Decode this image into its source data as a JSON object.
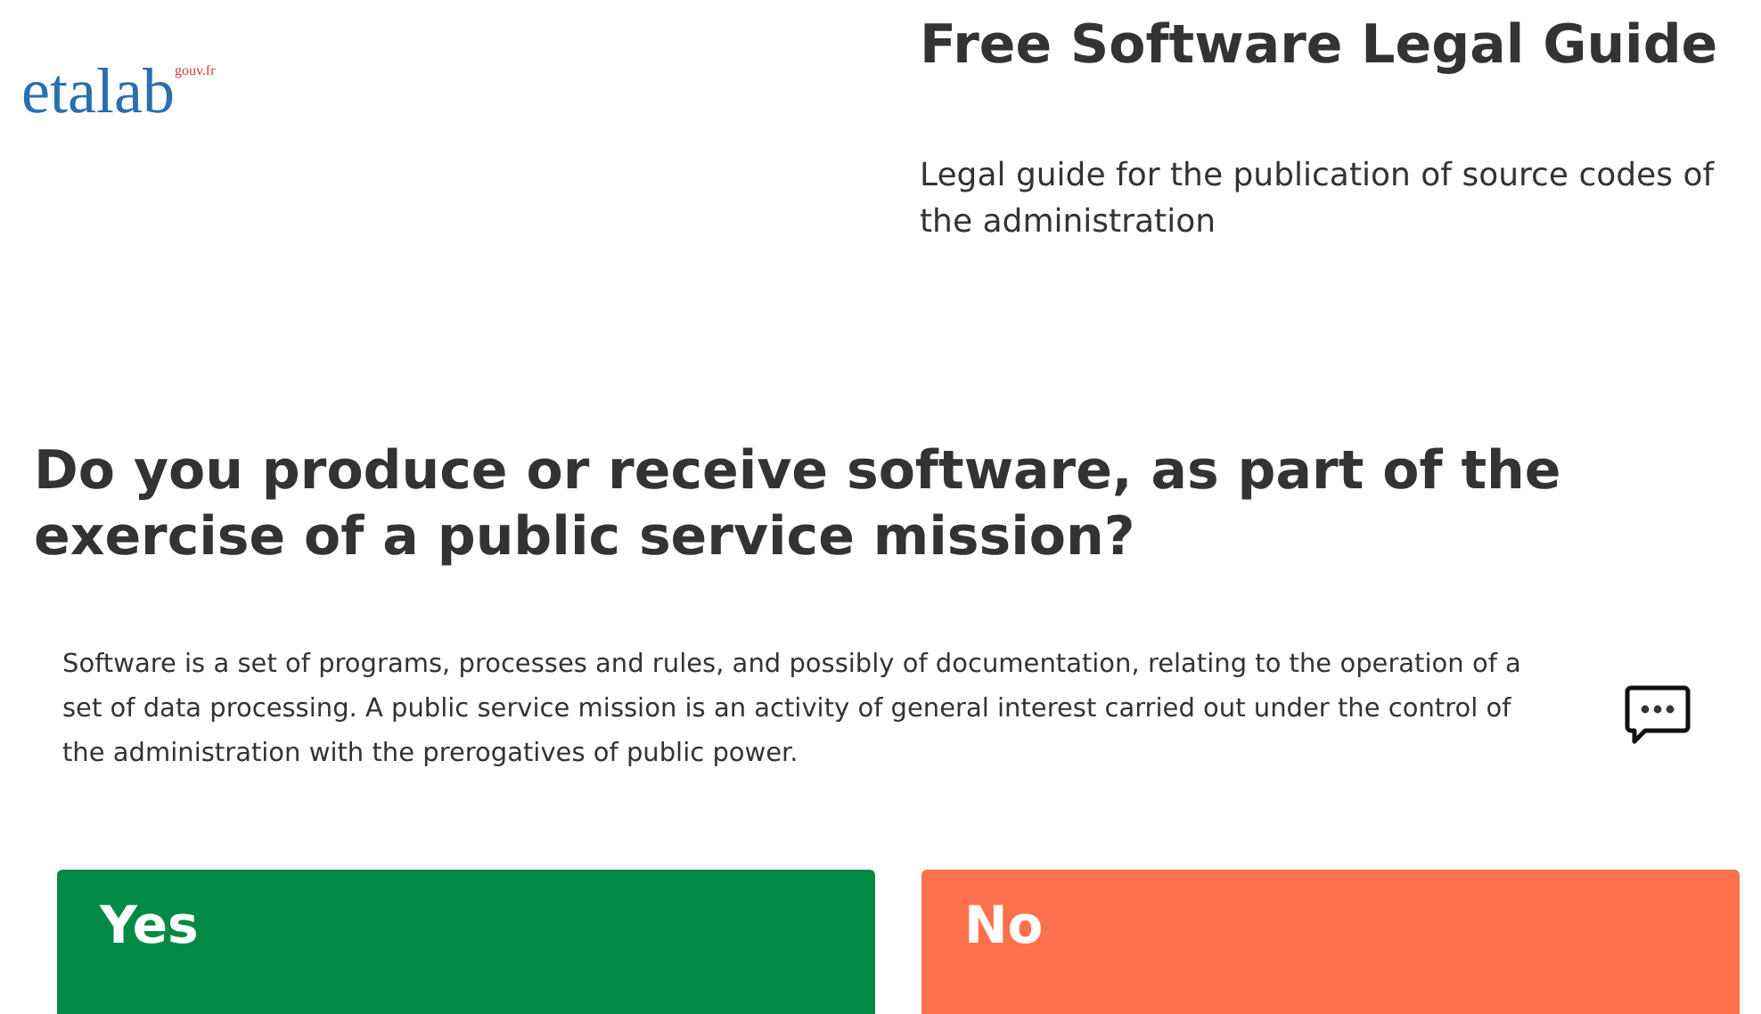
{
  "logo": {
    "name": "etalab",
    "suffix": "gouv.fr"
  },
  "header": {
    "title": "Free Software Legal Guide",
    "subtitle": "Legal guide for the publication of source codes of the administration"
  },
  "question": "Do you produce or receive software, as part of the exercise of a public service mission?",
  "description": "Software is a set of programs, processes and rules, and possibly of documentation, relating to the operation of a set of data processing. A public service mission is an activity of general interest carried out under the control of the administration with the prerogatives of public power.",
  "answers": [
    {
      "label": "Yes",
      "color": "#008a44"
    },
    {
      "label": "No",
      "color": "#ff704d"
    }
  ]
}
